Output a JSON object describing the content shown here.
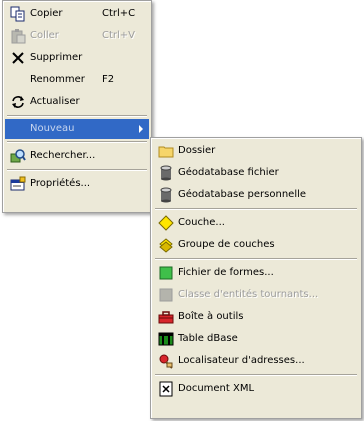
{
  "context_menu": {
    "items": [
      {
        "label": "Copier",
        "shortcut": "Ctrl+C",
        "icon": "copy-icon",
        "enabled": true
      },
      {
        "label": "Coller",
        "shortcut": "Ctrl+V",
        "icon": "paste-icon",
        "enabled": false
      },
      {
        "label": "Supprimer",
        "shortcut": "",
        "icon": "delete-icon",
        "enabled": true
      },
      {
        "label": "Renommer",
        "shortcut": "F2",
        "icon": "",
        "enabled": true
      },
      {
        "label": "Actualiser",
        "shortcut": "",
        "icon": "refresh-icon",
        "enabled": true
      },
      {
        "label": "Nouveau",
        "shortcut": "",
        "icon": "",
        "enabled": true,
        "highlighted": true,
        "has_submenu": true
      },
      {
        "label": "Rechercher...",
        "shortcut": "",
        "icon": "search-icon",
        "enabled": true
      },
      {
        "label": "Propriétés...",
        "shortcut": "",
        "icon": "properties-icon",
        "enabled": true
      }
    ]
  },
  "submenu_nouveau": {
    "items": [
      {
        "label": "Dossier",
        "icon": "folder-icon",
        "enabled": true
      },
      {
        "label": "Géodatabase fichier",
        "icon": "file-geodatabase-icon",
        "enabled": true
      },
      {
        "label": "Géodatabase personnelle",
        "icon": "personal-geodatabase-icon",
        "enabled": true
      },
      {
        "label": "Couche...",
        "icon": "layer-icon",
        "enabled": true
      },
      {
        "label": "Groupe de couches",
        "icon": "group-layer-icon",
        "enabled": true
      },
      {
        "label": "Fichier de formes...",
        "icon": "shapefile-icon",
        "enabled": true
      },
      {
        "label": "Classe d'entités tournants...",
        "icon": "turn-feature-class-icon",
        "enabled": false
      },
      {
        "label": "Boîte à outils",
        "icon": "toolbox-icon",
        "enabled": true
      },
      {
        "label": "Table dBase",
        "icon": "dbase-table-icon",
        "enabled": true
      },
      {
        "label": "Localisateur d'adresses...",
        "icon": "address-locator-icon",
        "enabled": true
      },
      {
        "label": "Document XML",
        "icon": "xml-document-icon",
        "enabled": true
      }
    ]
  },
  "colors": {
    "menu_background": "#ece9d8",
    "highlight": "#3169c6",
    "disabled_text": "#9d9d9d"
  }
}
